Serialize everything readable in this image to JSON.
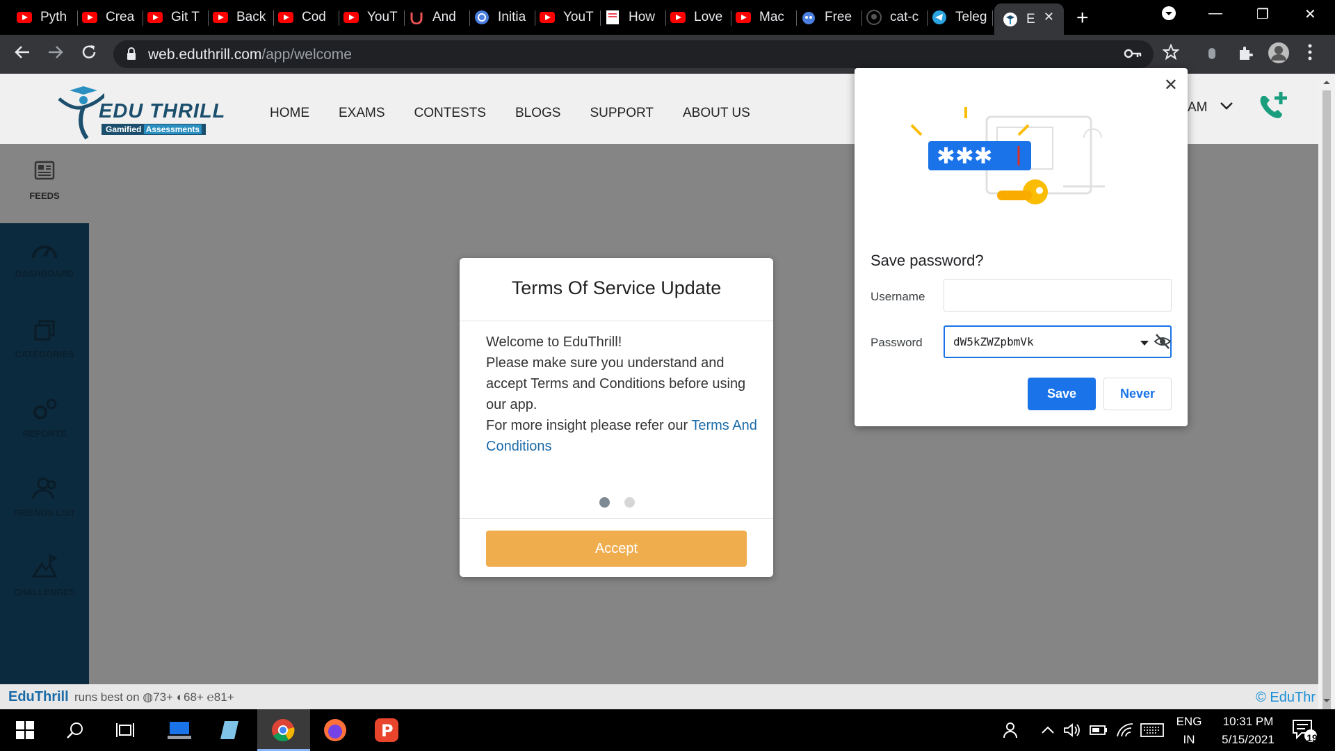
{
  "browser": {
    "tabs": [
      {
        "label": "Pyth",
        "icon": "youtube-icon"
      },
      {
        "label": "Crea",
        "icon": "youtube-icon"
      },
      {
        "label": "Git T",
        "icon": "youtube-icon"
      },
      {
        "label": "Back",
        "icon": "youtube-icon"
      },
      {
        "label": "Cod",
        "icon": "youtube-icon"
      },
      {
        "label": "YouT",
        "icon": "youtube-icon"
      },
      {
        "label": "And",
        "icon": "udemy-icon"
      },
      {
        "label": "Initia",
        "icon": "globe-icon"
      },
      {
        "label": "YouT",
        "icon": "youtube-icon"
      },
      {
        "label": "How",
        "icon": "doc-icon"
      },
      {
        "label": "Love",
        "icon": "youtube-icon"
      },
      {
        "label": "Mac",
        "icon": "youtube-icon"
      },
      {
        "label": "Free",
        "icon": "reddit-icon"
      },
      {
        "label": "cat-c",
        "icon": "github-icon"
      },
      {
        "label": "Teleg",
        "icon": "telegram-icon"
      },
      {
        "label": "E",
        "icon": "edu-icon",
        "active": true
      }
    ],
    "url_host": "web.eduthrill.com",
    "url_path": "/app/welcome"
  },
  "site": {
    "logo_brand": "EDU THRILL",
    "logo_tagline_a": "Gamified",
    "logo_tagline_b": "Assessments",
    "nav": [
      "HOME",
      "EXAMS",
      "CONTESTS",
      "BLOGS",
      "SUPPORT",
      "ABOUT US"
    ],
    "header_user_fragment": "AM",
    "sidebar": {
      "feeds": "FEEDS",
      "items": [
        "DASHBOARD",
        "CATEGORIES",
        "REPORTS",
        "FRIENDS LIST",
        "CHALLENGES"
      ]
    },
    "footer": {
      "brand": "EduThrill",
      "runs_best": "runs best on",
      "chrome_ver": "73+",
      "firefox_ver": "68+",
      "edge_ver": "81+",
      "copyright": "© EduThr"
    }
  },
  "modal": {
    "title": "Terms Of Service Update",
    "line1": "Welcome to EduThrill!",
    "line2": "Please make sure you understand and accept Terms and Conditions before using our app.",
    "line3_prefix": "For more insight please refer our ",
    "line3_link": "Terms And Conditions",
    "accept_label": "Accept",
    "colors": {
      "accept": "#f0ad4e",
      "link": "#1a6aa8"
    }
  },
  "password_bubble": {
    "heading": "Save password?",
    "username_label": "Username",
    "username_value": "",
    "password_label": "Password",
    "password_value": "dW5kZWZpbmVk",
    "save_label": "Save",
    "never_label": "Never",
    "colors": {
      "primary": "#1a73e8"
    }
  },
  "taskbar": {
    "lang_top": "ENG",
    "lang_bottom": "IN",
    "time": "10:31 PM",
    "date": "5/15/2021",
    "notification_count": "19"
  }
}
